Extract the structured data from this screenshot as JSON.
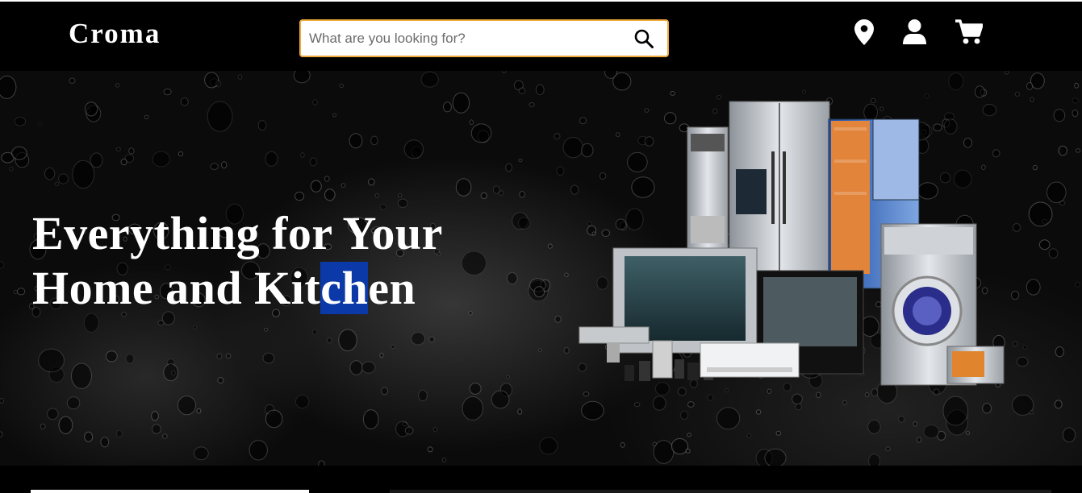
{
  "header": {
    "logo": "Croma",
    "search_placeholder": "What are you looking for?",
    "icons": [
      "location-icon",
      "user-icon",
      "cart-icon"
    ]
  },
  "hero": {
    "title_line1": "Everything for Your",
    "title_line2_pre": "Home and Kit",
    "title_line2_sel": "ch",
    "title_line2_post": "en"
  },
  "colors": {
    "background": "#000000",
    "search_border": "#f0a93b",
    "selection": "#0b3aa8",
    "text": "#ffffff"
  }
}
